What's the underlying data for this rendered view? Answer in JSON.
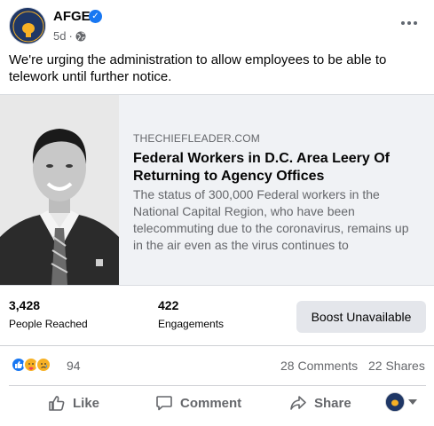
{
  "post": {
    "page_name": "AFGE",
    "avatar_text": "AFGE",
    "time": "5d",
    "separator": "·",
    "text": "We're urging the administration to allow employees to be able to telework until further notice."
  },
  "link": {
    "domain": "THECHIEFLEADER.COM",
    "title": "Federal Workers in D.C. Area Leery Of Returning to Agency Offices",
    "description": "The status of 300,000 Federal workers in the National Capital Region, who have been telecommuting due to the coronavirus, remains up in the air even as the virus continues to"
  },
  "insights": {
    "reached_value": "3,428",
    "reached_label": "People Reached",
    "engagements_value": "422",
    "engagements_label": "Engagements",
    "boost_label": "Boost Unavailable"
  },
  "reactions": {
    "count": "94",
    "comments": "28 Comments",
    "shares": "22 Shares",
    "types": [
      "like-icon",
      "care-icon",
      "sad-icon"
    ]
  },
  "actions": {
    "like": "Like",
    "comment": "Comment",
    "share": "Share"
  },
  "colors": {
    "brand_blue": "#1877f2",
    "afge_navy": "#1f3766",
    "gold": "#f7b125",
    "muted_text": "#65676b"
  }
}
